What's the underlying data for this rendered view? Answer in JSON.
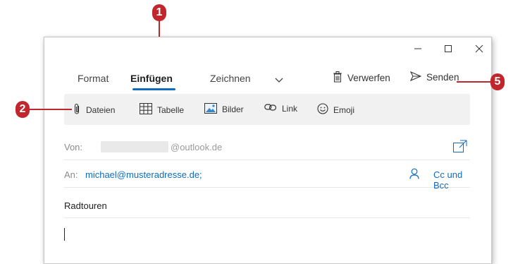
{
  "window": {
    "controls": {
      "minimize": "minimize",
      "maximize": "maximize",
      "close": "close"
    }
  },
  "tabs": {
    "format": "Format",
    "insert": "Einfügen",
    "draw": "Zeichnen"
  },
  "commands": {
    "discard": "Verwerfen",
    "send": "Senden"
  },
  "toolbar": {
    "files": "Dateien",
    "table": "Tabelle",
    "images": "Bilder",
    "link": "Link",
    "emoji": "Emoji"
  },
  "fields": {
    "from_label": "Von:",
    "from_domain": "@outlook.de",
    "to_label": "An:",
    "to_address": "michael@musteradresse.de;",
    "cc_bcc": "Cc und Bcc",
    "subject": "Radtouren"
  },
  "callouts": {
    "one": "1",
    "two": "2",
    "five": "5"
  },
  "colors": {
    "accent": "#0f6cbd",
    "callout": "#c0262b"
  }
}
